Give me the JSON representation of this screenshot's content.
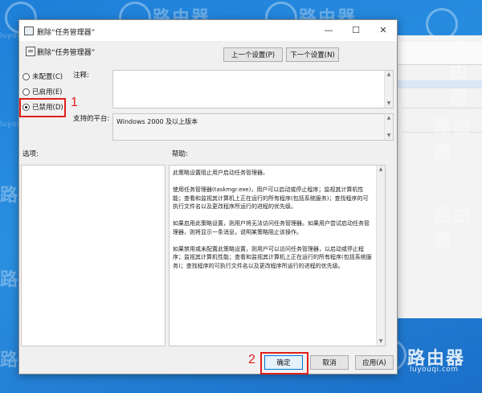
{
  "dialog": {
    "title": "删除“任务管理器”",
    "title_buttons": {
      "minimize": "—",
      "maximize": "☐",
      "close": "✕"
    },
    "header_text": "删除“任务管理器”",
    "prev_setting": "上一个设置(P)",
    "next_setting": "下一个设置(N)",
    "options": {
      "not_configured": "未配置(C)",
      "enabled": "已启用(E)",
      "disabled": "已禁用(D)",
      "selected": "disabled"
    },
    "comment_label": "注释:",
    "supported_label": "支持的平台:",
    "supported_value": "Windows 2000 及以上版本",
    "options_label": "选项:",
    "help_label": "帮助:",
    "help_paragraphs": [
      "此策略设置阻止用户启动任务管理器。",
      "使用任务管理器(taskmgr.exe)，用户可以启动或停止程序；监视其计算机性能；查看和监视其计算机上正在运行的所有程序(包括系统服务)；查找程序的可执行文件名以及更改程序所运行的进程的优先级。",
      "如果启用此策略设置，则用户将无法访问任务管理器。如果用户尝试启动任务管理器，则将显示一条消息，说明某策略阻止该操作。",
      "如果禁用或未配置此策略设置，则用户可以访问任务管理器，以启动或停止程序；监视其计算机性能；查看和监视其计算机上正在运行的所有程序(包括系统服务)；查找程序的可执行文件名以及更改程序所运行的进程的优先级。"
    ],
    "ok": "确定",
    "cancel": "取消",
    "apply": "应用(A)"
  },
  "annotations": {
    "step1": "1",
    "step2": "2"
  },
  "watermark": {
    "brand": "路由器",
    "domain": "luyouqi.com"
  },
  "colors": {
    "annotation_red": "#e0201b",
    "desktop_blue": "#1e7fd8"
  }
}
